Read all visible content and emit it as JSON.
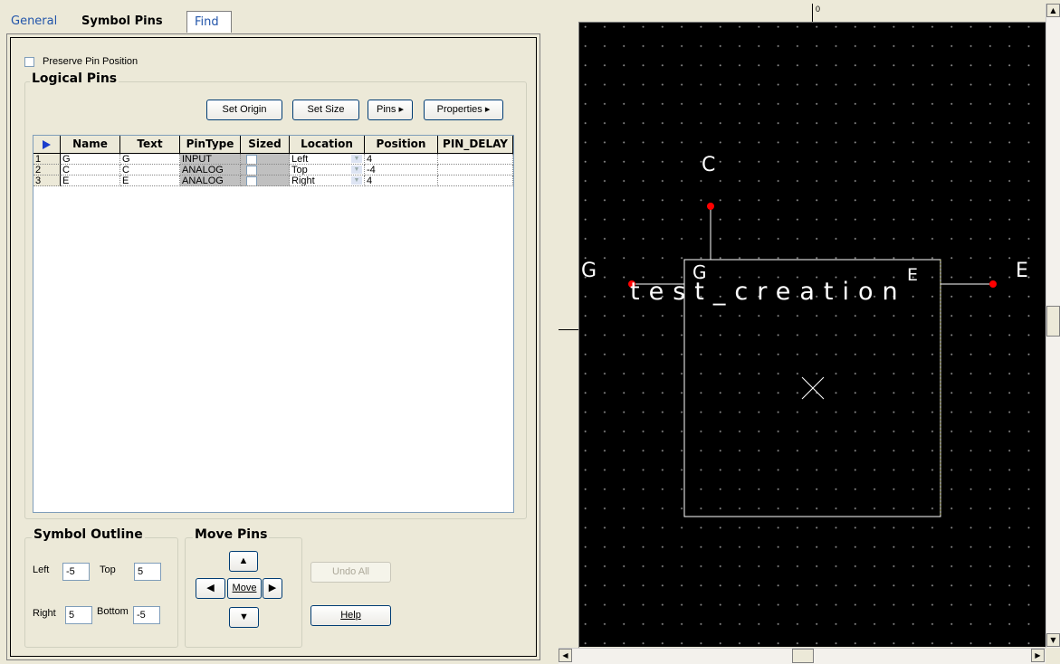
{
  "tabs": {
    "general": "General",
    "symbol_pins": "Symbol Pins",
    "find": "Find"
  },
  "preserve_pin_position": "Preserve Pin Position",
  "logical_pins": {
    "title": "Logical Pins",
    "buttons": {
      "set_origin": "Set Origin",
      "set_size": "Set Size",
      "pins": "Pins ▸",
      "properties": "Properties ▸"
    },
    "columns": [
      "Name",
      "Text",
      "PinType",
      "Sized",
      "Location",
      "Position",
      "PIN_DELAY"
    ],
    "rows": [
      {
        "num": "1",
        "name": "G",
        "text": "G",
        "pintype": "INPUT",
        "location": "Left",
        "position": "4",
        "pin_delay": ""
      },
      {
        "num": "2",
        "name": "C",
        "text": "C",
        "pintype": "ANALOG",
        "location": "Top",
        "position": "-4",
        "pin_delay": ""
      },
      {
        "num": "3",
        "name": "E",
        "text": "E",
        "pintype": "ANALOG",
        "location": "Right",
        "position": "4",
        "pin_delay": ""
      }
    ]
  },
  "symbol_outline": {
    "title": "Symbol Outline",
    "left_label": "Left",
    "left_value": "-5",
    "top_label": "Top",
    "top_value": "5",
    "right_label": "Right",
    "right_value": "5",
    "bottom_label": "Bottom",
    "bottom_value": "-5"
  },
  "move_pins": {
    "title": "Move Pins",
    "move_label": "Move",
    "undo_all": "Undo All",
    "help": "Help"
  },
  "canvas": {
    "ruler_origin": "0",
    "pin_labels": {
      "g_outside": "G",
      "g_inside": "G",
      "c_top": "C",
      "e_inside": "E",
      "e_outside": "E"
    },
    "component_name": "test_creation",
    "colors": {
      "background": "#000000",
      "pin_dot": "#ff0000",
      "outline": "#ffffff"
    }
  }
}
